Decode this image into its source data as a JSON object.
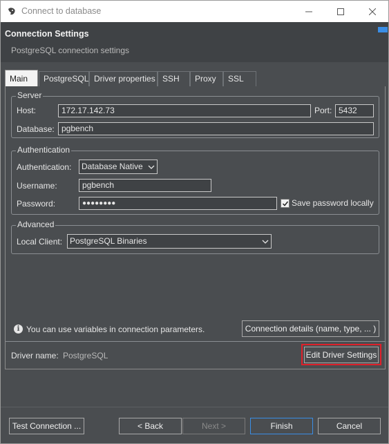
{
  "window": {
    "title": "Connect to database"
  },
  "header": {
    "title": "Connection Settings",
    "subtitle": "PostgreSQL connection settings"
  },
  "tabs": [
    {
      "label": "Main",
      "active": true
    },
    {
      "label": "PostgreSQL",
      "active": false
    },
    {
      "label": "Driver properties",
      "active": false
    },
    {
      "label": "SSH",
      "active": false
    },
    {
      "label": "Proxy",
      "active": false
    },
    {
      "label": "SSL",
      "active": false
    }
  ],
  "server": {
    "group_label": "Server",
    "host_label": "Host:",
    "host_value": "172.17.142.73",
    "port_label": "Port:",
    "port_value": "5432",
    "database_label": "Database:",
    "database_value": "pgbench"
  },
  "authentication": {
    "group_label": "Authentication",
    "auth_label": "Authentication:",
    "auth_value": "Database Native",
    "username_label": "Username:",
    "username_value": "pgbench",
    "password_label": "Password:",
    "password_value": "●●●●●●●●",
    "save_password_label": "Save password locally",
    "save_password_checked": true
  },
  "advanced": {
    "group_label": "Advanced",
    "local_client_label": "Local Client:",
    "local_client_value": "PostgreSQL Binaries"
  },
  "info": {
    "text": "You can use variables in connection parameters.",
    "details_button": "Connection details (name, type, ... )"
  },
  "driver": {
    "label": "Driver name:",
    "value": "PostgreSQL",
    "edit_button": "Edit Driver Settings"
  },
  "footer": {
    "test_button": "Test Connection ...",
    "back_button": "< Back",
    "next_button": "Next >",
    "finish_button": "Finish",
    "cancel_button": "Cancel"
  },
  "colors": {
    "background": "#4a4d50",
    "header": "#3f4245",
    "accent": "#3a8ee6",
    "highlight": "#e0202a"
  }
}
